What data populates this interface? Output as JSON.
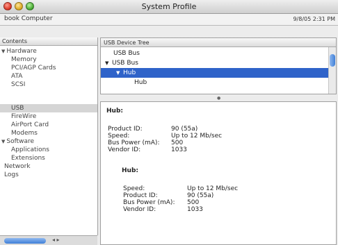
{
  "window": {
    "title": "System Profile"
  },
  "infobar": {
    "computer": "book Computer",
    "date": "9/8/05 2:31 PM"
  },
  "sidebar": {
    "header": "Contents",
    "items": [
      {
        "label": "Hardware",
        "level": 0,
        "expanded": true
      },
      {
        "label": "Memory",
        "level": 1
      },
      {
        "label": "PCI/AGP Cards",
        "level": 1
      },
      {
        "label": "ATA",
        "level": 1
      },
      {
        "label": "SCSI",
        "level": 1
      },
      {
        "label": "USB",
        "level": 1,
        "selected": true
      },
      {
        "label": "FireWire",
        "level": 1
      },
      {
        "label": "AirPort Card",
        "level": 1
      },
      {
        "label": "Modems",
        "level": 1
      },
      {
        "label": "Software",
        "level": 0,
        "expanded": true
      },
      {
        "label": "Applications",
        "level": 1
      },
      {
        "label": "Extensions",
        "level": 1
      },
      {
        "label": "Network",
        "level": 0
      },
      {
        "label": "Logs",
        "level": 0
      }
    ]
  },
  "tree": {
    "header": "USB Device Tree",
    "rows": [
      {
        "label": "USB Bus",
        "indent": 1
      },
      {
        "label": "USB Bus",
        "indent": 1,
        "expanded": true
      },
      {
        "label": "Hub",
        "indent": 2,
        "expanded": true,
        "selected": true
      },
      {
        "label": "Hub",
        "indent": 3
      }
    ]
  },
  "detail": {
    "heading": "Hub:",
    "product_id_label": "Product ID:",
    "product_id": "90 (55a)",
    "speed_label": "Speed:",
    "speed": "Up to 12 Mb/sec",
    "bus_power_label": "Bus Power (mA):",
    "bus_power": "500",
    "vendor_id_label": "Vendor ID:",
    "vendor_id": "1033",
    "sub": {
      "heading": "Hub:",
      "speed_label": "Speed:",
      "speed": "Up to 12 Mb/sec",
      "product_id_label": "Product ID:",
      "product_id": "90 (55a)",
      "bus_power_label": "Bus Power (mA):",
      "bus_power": "500",
      "vendor_id_label": "Vendor ID:",
      "vendor_id": "1033"
    }
  },
  "colors": {
    "selection": "#2f63c9",
    "sidebar_selection": "#d5d5d5"
  }
}
